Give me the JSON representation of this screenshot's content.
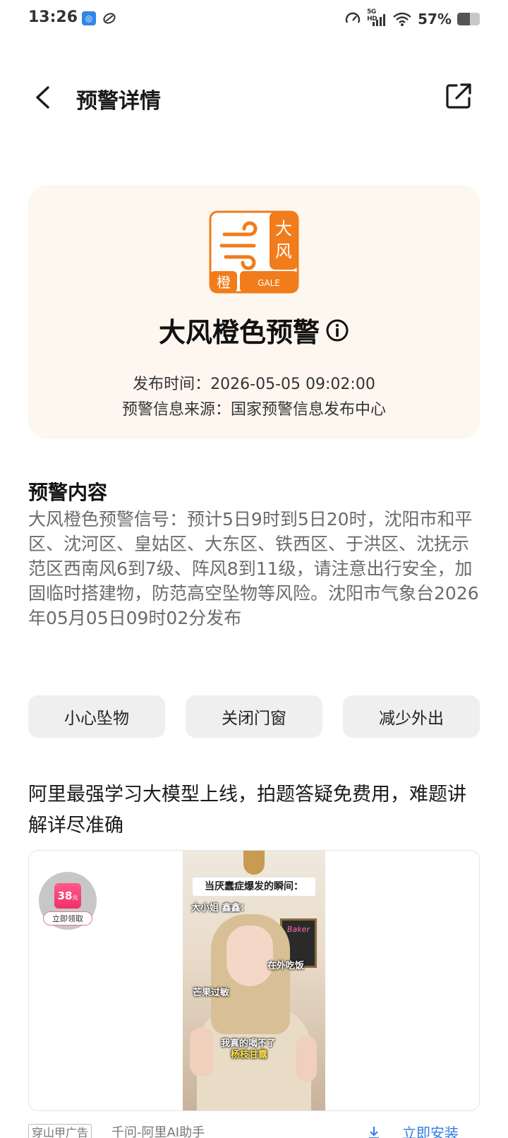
{
  "status_bar": {
    "time": "13:26",
    "network_label": "5G HD",
    "battery_percent": "57%",
    "battery_level": 0.57
  },
  "header": {
    "title": "预警详情"
  },
  "warning": {
    "icon": {
      "char_top": "大",
      "char_bottom": "风",
      "level_char": "橙",
      "english_label": "GALE",
      "color": "#f07c1c"
    },
    "title": "大风橙色预警",
    "publish_time": "发布时间：2026-05-05 09:02:00",
    "source": "预警信息来源：国家预警信息发布中心"
  },
  "content": {
    "section_title": "预警内容",
    "body": "大风橙色预警信号：预计5日9时到5日20时，沈阳市和平区、沈河区、皇姑区、大东区、铁西区、于洪区、沈抚示范区西南风6到7级、阵风8到11级，请注意出行安全，加固临时搭建物，防范高空坠物等风险。沈阳市气象台2026年05月05日09时02分发布"
  },
  "chips": [
    "小心坠物",
    "关闭门窗",
    "减少外出"
  ],
  "ad": {
    "title": "阿里最强学习大模型上线，拍题答疑免费用，难题讲解详尽准确",
    "coupon_amount": "38",
    "coupon_unit": "元",
    "coupon_button": "立即领取",
    "video_captions": {
      "headline": "当厌蠢症爆发的瞬间：",
      "c1": "大小姐 鑫鑫：",
      "c2": "在外吃饭",
      "c3": "芒果过敏",
      "c4": "我真的喝不了",
      "c5": "杨枝甘露"
    },
    "board_text": "Baker",
    "tag": "穿山甲广告",
    "source": "千问-阿里AI助手",
    "install_label": "立即安装"
  }
}
